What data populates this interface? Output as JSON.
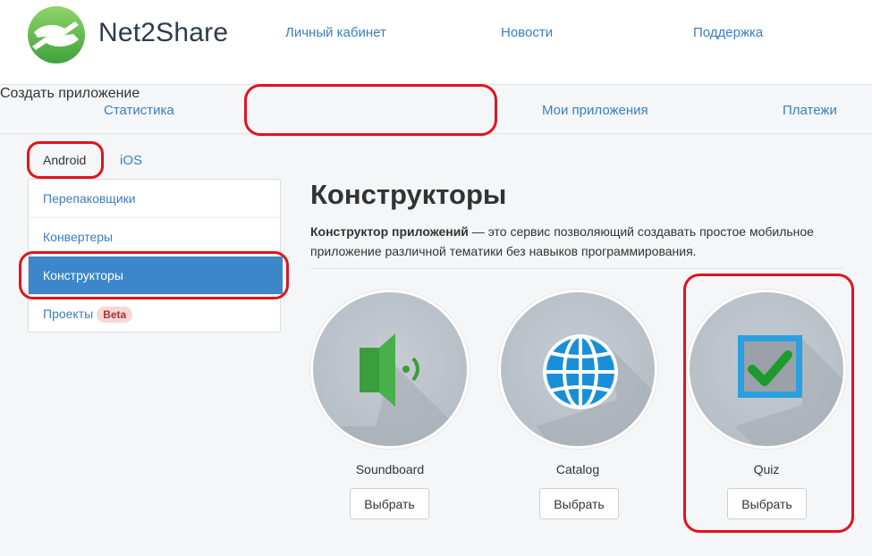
{
  "brand": {
    "name": "Net2Share"
  },
  "topnav": [
    {
      "label": "Личный кабинет"
    },
    {
      "label": "Новости"
    },
    {
      "label": "Поддержка"
    }
  ],
  "subnav": [
    {
      "label": "Статистика"
    },
    {
      "label": "Создать приложение",
      "active": true
    },
    {
      "label": "Мои приложения"
    },
    {
      "label": "Платежи"
    }
  ],
  "platform_tabs": [
    {
      "label": "Android",
      "active": true
    },
    {
      "label": "iOS"
    }
  ],
  "sidebar": {
    "items": [
      {
        "label": "Перепаковщики"
      },
      {
        "label": "Конвертеры"
      },
      {
        "label": "Конструкторы",
        "active": true
      },
      {
        "label": "Проекты",
        "badge": "Beta"
      }
    ]
  },
  "main": {
    "title": "Конструкторы",
    "desc_bold": "Конструктор приложений",
    "desc_rest": " — это сервис позволяющий создавать простое мобильное приложение различной тематики без навыков программирования."
  },
  "cards": [
    {
      "name": "Soundboard",
      "icon": "speaker-icon",
      "button": "Выбрать"
    },
    {
      "name": "Catalog",
      "icon": "globe-icon",
      "button": "Выбрать"
    },
    {
      "name": "Quiz",
      "icon": "checkbox-icon",
      "button": "Выбрать"
    }
  ],
  "colors": {
    "accent": "#3b87c9",
    "link": "#3a7ec1",
    "annotation": "#e0141e",
    "brand_green": "#5cb84a"
  }
}
